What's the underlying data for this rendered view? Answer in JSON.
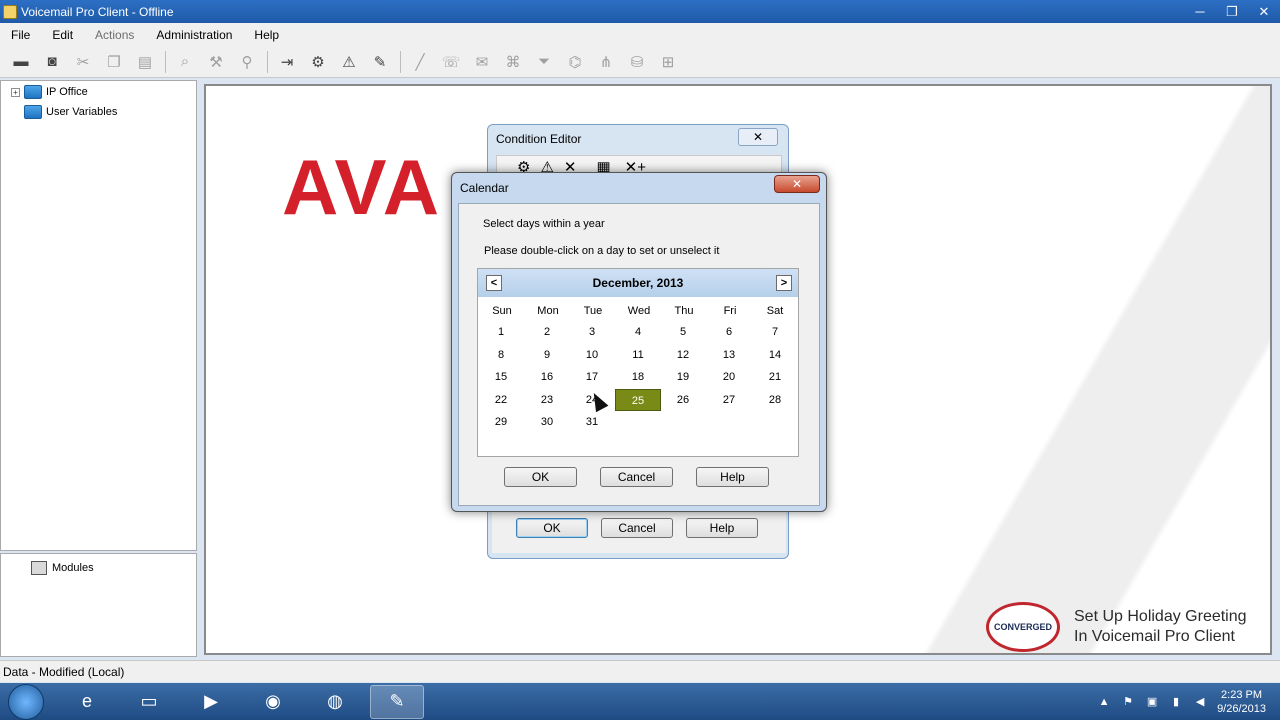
{
  "window": {
    "title": "Voicemail Pro Client - Offline",
    "controls": [
      "─",
      "❐",
      "✕"
    ]
  },
  "menu": {
    "items": [
      {
        "label": "File",
        "enabled": true
      },
      {
        "label": "Edit",
        "enabled": true
      },
      {
        "label": "Actions",
        "enabled": false
      },
      {
        "label": "Administration",
        "enabled": true
      },
      {
        "label": "Help",
        "enabled": true
      }
    ]
  },
  "tree": {
    "ip_office": "IP Office",
    "user_variables": "User Variables",
    "modules": "Modules"
  },
  "status": {
    "text": "Data - Modified (Local)"
  },
  "background": {
    "logo_text": "AVA",
    "brand_logo": "CONVERGED",
    "caption_line1": "Set Up Holiday Greeting",
    "caption_line2": "In Voicemail Pro Client"
  },
  "condition_editor": {
    "title": "Condition Editor",
    "close": "✕",
    "ok": "OK",
    "cancel": "Cancel",
    "help": "Help"
  },
  "calendar": {
    "title": "Calendar",
    "close": "✕",
    "prompt_select": "Select days within a year",
    "prompt_instructions": "Please double-click on a day to set or unselect it",
    "month_label": "December, 2013",
    "prev": "<",
    "next": ">",
    "weekdays": [
      "Sun",
      "Mon",
      "Tue",
      "Wed",
      "Thu",
      "Fri",
      "Sat"
    ],
    "weeks": [
      [
        "1",
        "2",
        "3",
        "4",
        "5",
        "6",
        "7"
      ],
      [
        "8",
        "9",
        "10",
        "11",
        "12",
        "13",
        "14"
      ],
      [
        "15",
        "16",
        "17",
        "18",
        "19",
        "20",
        "21"
      ],
      [
        "22",
        "23",
        "24",
        "25",
        "26",
        "27",
        "28"
      ],
      [
        "29",
        "30",
        "31",
        "",
        "",
        "",
        ""
      ]
    ],
    "selected_day": "25",
    "ok": "OK",
    "cancel": "Cancel",
    "help": "Help"
  },
  "taskbar": {
    "clock_time": "2:23 PM",
    "clock_date": "9/26/2013"
  },
  "colors": {
    "selected_day": "#7a8a16",
    "avaya_red": "#d4202a",
    "titlebar": "#2c6fc4"
  }
}
